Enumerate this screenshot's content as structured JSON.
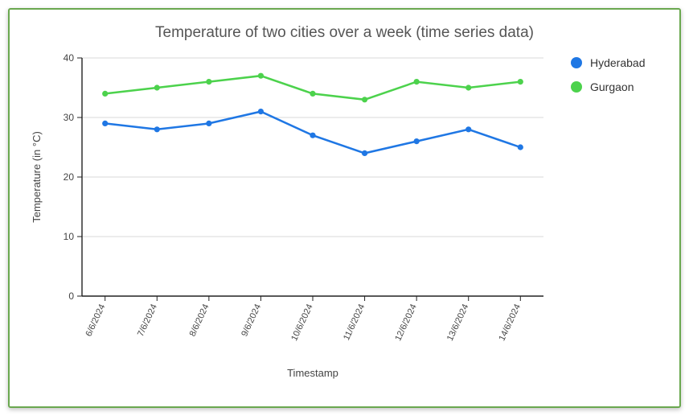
{
  "chart_data": {
    "type": "line",
    "title": "Temperature of two cities over a week (time series data)",
    "xlabel": "Timestamp",
    "ylabel": "Temperature (in °C)",
    "ylim": [
      0,
      40
    ],
    "yticks": [
      0,
      10,
      20,
      30,
      40
    ],
    "categories": [
      "6/6/2024",
      "7/6/2024",
      "8/6/2024",
      "9/6/2024",
      "10/6/2024",
      "11/6/2024",
      "12/6/2024",
      "13/6/2024",
      "14/6/2024"
    ],
    "series": [
      {
        "name": "Hyderabad",
        "color": "#1f77e4",
        "values": [
          29,
          28,
          29,
          31,
          27,
          24,
          26,
          28,
          25
        ]
      },
      {
        "name": "Gurgaon",
        "color": "#4cd24c",
        "values": [
          34,
          35,
          36,
          37,
          34,
          33,
          36,
          35,
          36
        ]
      }
    ],
    "legend_position": "right",
    "grid": true
  }
}
